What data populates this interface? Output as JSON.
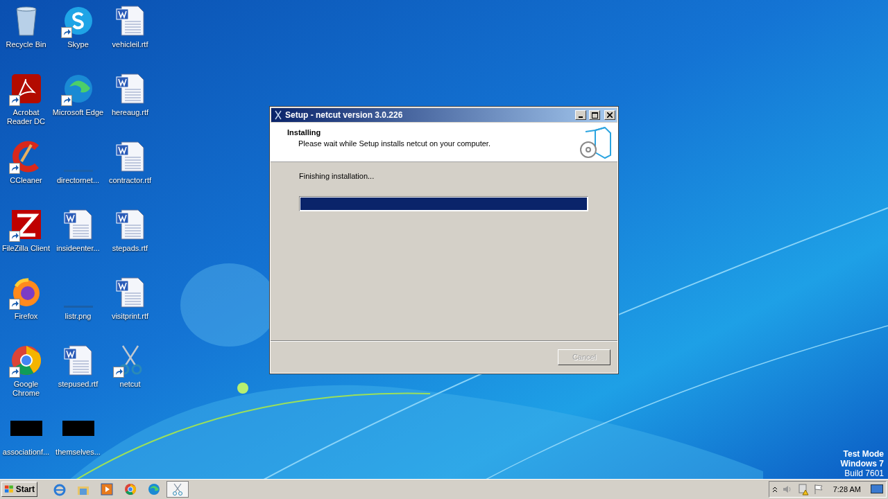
{
  "desktop_icons": [
    {
      "label": "Recycle Bin",
      "kind": "recycle-bin",
      "shortcut": false
    },
    {
      "label": "Skype",
      "kind": "skype",
      "shortcut": true
    },
    {
      "label": "vehicleil.rtf",
      "kind": "word-doc",
      "shortcut": false
    },
    {
      "label": "Acrobat Reader DC",
      "kind": "acrobat",
      "shortcut": true
    },
    {
      "label": "Microsoft Edge",
      "kind": "edge",
      "shortcut": true
    },
    {
      "label": "hereaug.rtf",
      "kind": "word-doc",
      "shortcut": false
    },
    {
      "label": "CCleaner",
      "kind": "ccleaner",
      "shortcut": true
    },
    {
      "label": "directornet...",
      "kind": "blank",
      "shortcut": false
    },
    {
      "label": "contractor.rtf",
      "kind": "word-doc",
      "shortcut": false
    },
    {
      "label": "FileZilla Client",
      "kind": "filezilla",
      "shortcut": true
    },
    {
      "label": "insideenter...",
      "kind": "word-doc",
      "shortcut": false
    },
    {
      "label": "stepads.rtf",
      "kind": "word-doc",
      "shortcut": false
    },
    {
      "label": "Firefox",
      "kind": "firefox",
      "shortcut": true
    },
    {
      "label": "listr.png",
      "kind": "blank",
      "shortcut": false
    },
    {
      "label": "visitprint.rtf",
      "kind": "word-doc",
      "shortcut": false
    },
    {
      "label": "Google Chrome",
      "kind": "chrome",
      "shortcut": true
    },
    {
      "label": "stepused.rtf",
      "kind": "word-doc",
      "shortcut": false
    },
    {
      "label": "netcut",
      "kind": "scissors",
      "shortcut": true
    },
    {
      "label": "associationf...",
      "kind": "black",
      "shortcut": false
    },
    {
      "label": "themselves...",
      "kind": "black",
      "shortcut": false
    }
  ],
  "dialog": {
    "title": "Setup - netcut version 3.0.226",
    "heading": "Installing",
    "subheading": "Please wait while Setup installs netcut on your computer.",
    "status": "Finishing installation...",
    "progress": {
      "level": 1.0
    },
    "cancel": {
      "label": "Cancel",
      "disabled": true
    }
  },
  "desktop_notice": [
    "Test Mode",
    "Windows 7",
    "Build 7601"
  ],
  "taskbar": {
    "start": "Start",
    "items": [
      {
        "kind": "ie",
        "selected": false
      },
      {
        "kind": "explorer",
        "selected": false
      },
      {
        "kind": "media",
        "selected": false
      },
      {
        "kind": "chrome",
        "selected": false
      },
      {
        "kind": "edge",
        "selected": false
      },
      {
        "kind": "scissors",
        "selected": true
      }
    ],
    "clock": "7:28 AM"
  }
}
